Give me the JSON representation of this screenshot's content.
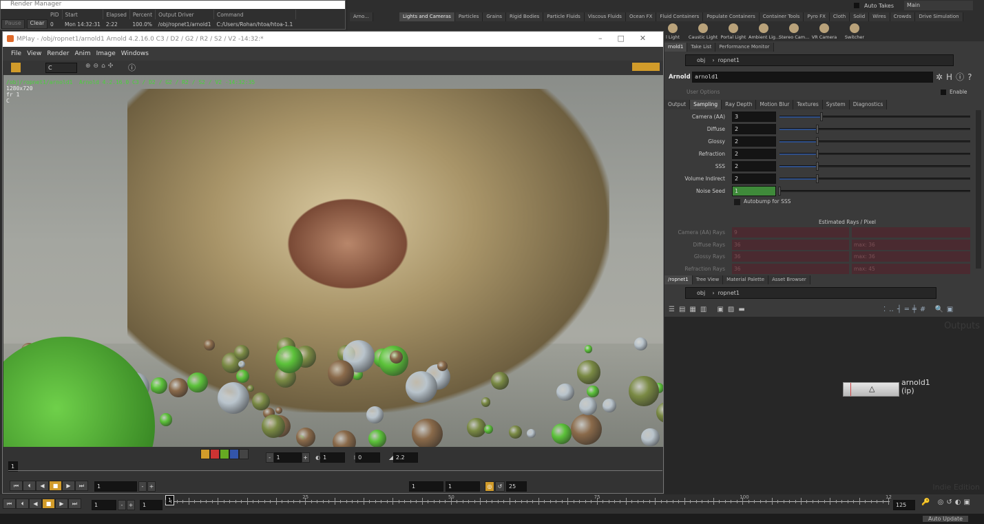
{
  "shelf": {
    "auto_takes": "Auto Takes",
    "take": "Main",
    "left_tab": "Arno...",
    "tabs": [
      "Lights and Cameras",
      "Particles",
      "Grains",
      "Rigid Bodies",
      "Particle Fluids",
      "Viscous Fluids",
      "Ocean FX",
      "Fluid Containers",
      "Populate Containers",
      "Container Tools",
      "Pyro FX",
      "Cloth",
      "Solid",
      "Wires",
      "Crowds",
      "Drive Simulation"
    ],
    "tools": [
      "l Light",
      "Caustic Light",
      "Portal Light",
      "Ambient Lig...",
      "Stereo Cam...",
      "VR Camera",
      "Switcher"
    ]
  },
  "render_manager": {
    "title": "Render Manager",
    "pause": "Pause",
    "clear": "Clear",
    "columns": [
      "PID",
      "Start",
      "Elapsed",
      "Percent",
      "Output Driver",
      "Command"
    ],
    "row": [
      "0",
      "Mon 14:32:31",
      "2:22",
      "100.0%",
      "/obj/ropnet1/arnold1",
      "C:/Users/Rohan/htoa/htoa-1.1"
    ]
  },
  "mplay": {
    "title": "MPlay - /obj/ropnet1/arnold1   Arnold 4.2.16.0   C3 / D2 / G2 / R2 / S2 / V2 -14:32:*",
    "menu": [
      "File",
      "View",
      "Render",
      "Anim",
      "Image",
      "Windows"
    ],
    "channel": "C",
    "overlay": {
      "path": "/obj/ropnet1/arnold1",
      "renderer": "Arnold 4.2.16.0   C3 / D2 / G2 / R2 / S2 / V2 -14:32:35",
      "res": "1280x720",
      "frame": "fr 1",
      "channel": "C"
    },
    "controls": {
      "exposure_step": "1",
      "brightness": "1",
      "offset": "0",
      "gamma": "2.2"
    },
    "frame_marker": "1",
    "frame_field": "1",
    "range_start": "1",
    "range_end": "1",
    "fps": "25"
  },
  "right_panel": {
    "tabs": [
      "rnold1",
      "Take List",
      "Performance Monitor"
    ],
    "path": [
      "obj",
      "ropnet1"
    ],
    "node_type": "Arnold",
    "node_name": "arnold1",
    "user_options": "User Options",
    "enable": "Enable",
    "param_tabs": [
      "Output",
      "Sampling",
      "Ray Depth",
      "Motion Blur",
      "Textures",
      "System",
      "Diagnostics"
    ],
    "active_param_tab": "Sampling",
    "params": [
      {
        "label": "Camera (AA)",
        "value": "3",
        "fraction": 0.22
      },
      {
        "label": "Diffuse",
        "value": "2",
        "fraction": 0.2
      },
      {
        "label": "Glossy",
        "value": "2",
        "fraction": 0.2
      },
      {
        "label": "Refraction",
        "value": "2",
        "fraction": 0.2
      },
      {
        "label": "SSS",
        "value": "2",
        "fraction": 0.2
      },
      {
        "label": "Volume Indirect",
        "value": "2",
        "fraction": 0.2
      },
      {
        "label": "Noise Seed",
        "value": "1",
        "fraction": 0
      }
    ],
    "autobump": "Autobump for SSS",
    "estimated": "Estimated Rays / Pixel",
    "rays": [
      {
        "label": "Camera (AA) Rays",
        "value": "9",
        "max": ""
      },
      {
        "label": "Diffuse Rays",
        "value": "36",
        "max": "max: 36"
      },
      {
        "label": "Glossy Rays",
        "value": "36",
        "max": "max: 36"
      },
      {
        "label": "Refraction Rays",
        "value": "36",
        "max": "max: 45"
      }
    ]
  },
  "network": {
    "tabs": [
      "/ropnet1",
      "Tree View",
      "Material Palette",
      "Asset Browser"
    ],
    "path": [
      "obj",
      "ropnet1"
    ],
    "context": "Outputs",
    "node": {
      "name": "arnold1",
      "status": "(ip)"
    },
    "watermark": "Indie Edition"
  },
  "timeline": {
    "frame": "1",
    "start": "1",
    "current_marker": "1",
    "ticks": [
      "25",
      "50",
      "75",
      "100",
      "12"
    ],
    "end": "125",
    "auto_update": "Auto Update"
  },
  "colors": {
    "accent": "#d19b2a",
    "overlay_text": "#49d239",
    "noise_seed": "#3f8a3a"
  }
}
